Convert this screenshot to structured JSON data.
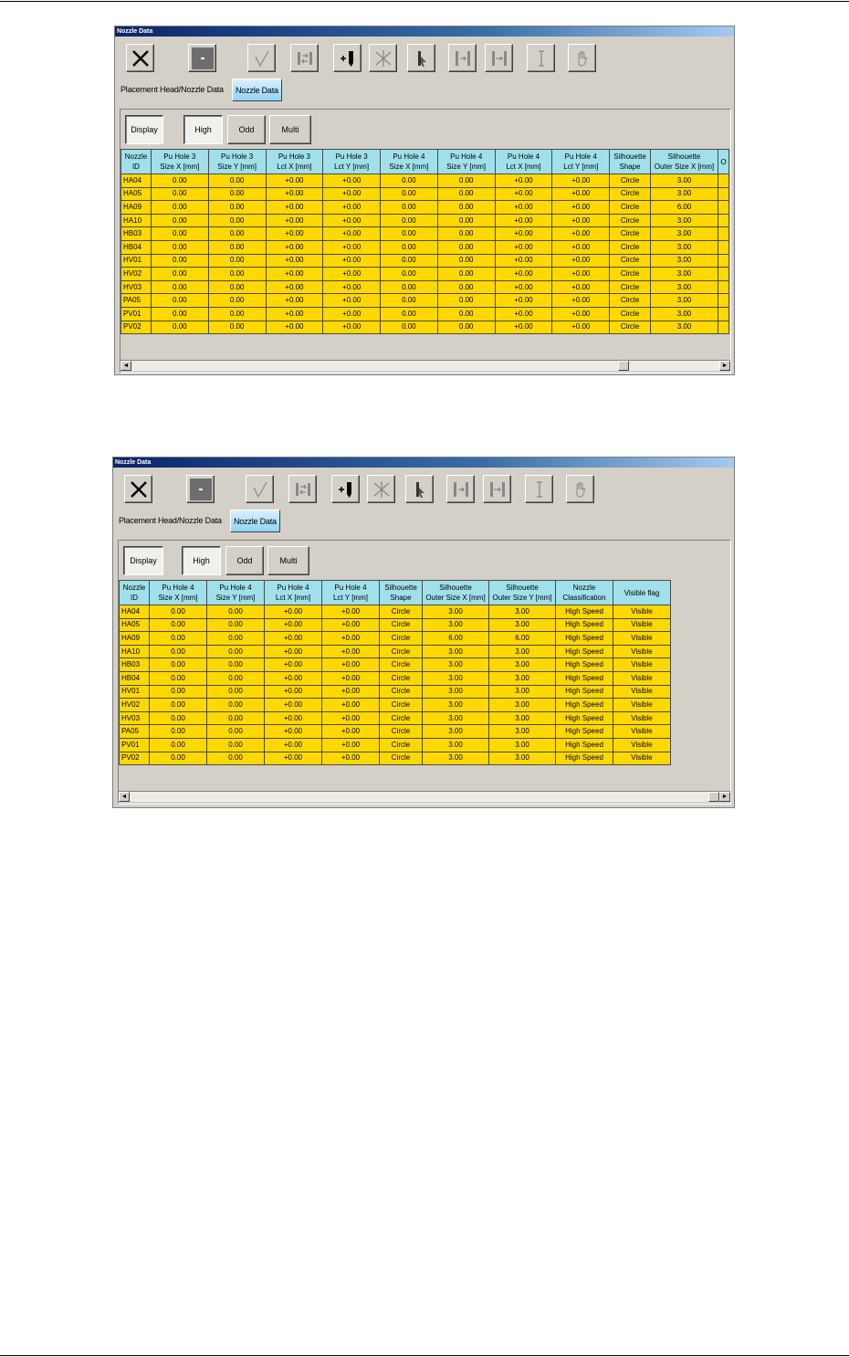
{
  "window_title": "Nozzle Data",
  "tabs": [
    "Placement Head/Nozzle Data",
    "Nozzle Data"
  ],
  "filters": [
    "Display",
    "High",
    "Odd",
    "Multi"
  ],
  "toolbar_icons": [
    "close-x-icon",
    "stop-icon",
    "checkmark-icon",
    "swap-icon",
    "add-nozzle-icon",
    "split-icon",
    "pointer-icon",
    "step-forward-icon",
    "skip-end-icon",
    "cursor-i-icon",
    "hand-icon"
  ],
  "scroll": {
    "left_arrow": "◄",
    "right_arrow": "►"
  },
  "colors": {
    "header": "#9fe0ea",
    "cell": "#ffd800",
    "active_tab": "#8fd3f5"
  },
  "grid1": {
    "headers": [
      [
        "Nozzle",
        "ID"
      ],
      [
        "Pu Hole 3",
        "Size X [mm]"
      ],
      [
        "Pu Hole 3",
        "Size Y [mm]"
      ],
      [
        "Pu Hole 3",
        "Lct X [mm]"
      ],
      [
        "Pu Hole 3",
        "Lct Y [mm]"
      ],
      [
        "Pu Hole 4",
        "Size X [mm]"
      ],
      [
        "Pu Hole 4",
        "Size Y [mm]"
      ],
      [
        "Pu Hole 4",
        "Lct X [mm]"
      ],
      [
        "Pu Hole 4",
        "Lct Y [mm]"
      ],
      [
        "Silhouette",
        "Shape"
      ],
      [
        "Silhouette",
        "Outer Size X [mm]"
      ],
      [
        "",
        "O"
      ]
    ],
    "rows": [
      [
        "HA04",
        "0.00",
        "0.00",
        "+0.00",
        "+0.00",
        "0.00",
        "0.00",
        "+0.00",
        "+0.00",
        "Circle",
        "3.00",
        ""
      ],
      [
        "HA05",
        "0.00",
        "0.00",
        "+0.00",
        "+0.00",
        "0.00",
        "0.00",
        "+0.00",
        "+0.00",
        "Circle",
        "3.00",
        ""
      ],
      [
        "HA09",
        "0.00",
        "0.00",
        "+0.00",
        "+0.00",
        "0.00",
        "0.00",
        "+0.00",
        "+0.00",
        "Circle",
        "6.00",
        ""
      ],
      [
        "HA10",
        "0.00",
        "0.00",
        "+0.00",
        "+0.00",
        "0.00",
        "0.00",
        "+0.00",
        "+0.00",
        "Circle",
        "3.00",
        ""
      ],
      [
        "HB03",
        "0.00",
        "0.00",
        "+0.00",
        "+0.00",
        "0.00",
        "0.00",
        "+0.00",
        "+0.00",
        "Circle",
        "3.00",
        ""
      ],
      [
        "HB04",
        "0.00",
        "0.00",
        "+0.00",
        "+0.00",
        "0.00",
        "0.00",
        "+0.00",
        "+0.00",
        "Circle",
        "3.00",
        ""
      ],
      [
        "HV01",
        "0.00",
        "0.00",
        "+0.00",
        "+0.00",
        "0.00",
        "0.00",
        "+0.00",
        "+0.00",
        "Circle",
        "3.00",
        ""
      ],
      [
        "HV02",
        "0.00",
        "0.00",
        "+0.00",
        "+0.00",
        "0.00",
        "0.00",
        "+0.00",
        "+0.00",
        "Circle",
        "3.00",
        ""
      ],
      [
        "HV03",
        "0.00",
        "0.00",
        "+0.00",
        "+0.00",
        "0.00",
        "0.00",
        "+0.00",
        "+0.00",
        "Circle",
        "3.00",
        ""
      ],
      [
        "PA05",
        "0.00",
        "0.00",
        "+0.00",
        "+0.00",
        "0.00",
        "0.00",
        "+0.00",
        "+0.00",
        "Circle",
        "3.00",
        ""
      ],
      [
        "PV01",
        "0.00",
        "0.00",
        "+0.00",
        "+0.00",
        "0.00",
        "0.00",
        "+0.00",
        "+0.00",
        "Circle",
        "3.00",
        ""
      ],
      [
        "PV02",
        "0.00",
        "0.00",
        "+0.00",
        "+0.00",
        "0.00",
        "0.00",
        "+0.00",
        "+0.00",
        "Circle",
        "3.00",
        ""
      ]
    ]
  },
  "grid2": {
    "headers": [
      [
        "Nozzle",
        "ID"
      ],
      [
        "Pu Hole 4",
        "Size X [mm]"
      ],
      [
        "Pu Hole 4",
        "Size Y [mm]"
      ],
      [
        "Pu Hole 4",
        "Lct X [mm]"
      ],
      [
        "Pu Hole 4",
        "Lct Y [mm]"
      ],
      [
        "Silhouette",
        "Shape"
      ],
      [
        "Silhouette",
        "Outer Size X [mm]"
      ],
      [
        "Silhouette",
        "Outer Size Y [mm]"
      ],
      [
        "Nozzle",
        "Classification"
      ],
      [
        "Visible flag",
        ""
      ]
    ],
    "rows": [
      [
        "HA04",
        "0.00",
        "0.00",
        "+0.00",
        "+0.00",
        "Circle",
        "3.00",
        "3.00",
        "High Speed",
        "Visible"
      ],
      [
        "HA05",
        "0.00",
        "0.00",
        "+0.00",
        "+0.00",
        "Circle",
        "3.00",
        "3.00",
        "High Speed",
        "Visible"
      ],
      [
        "HA09",
        "0.00",
        "0.00",
        "+0.00",
        "+0.00",
        "Circle",
        "6.00",
        "6.00",
        "High Speed",
        "Visible"
      ],
      [
        "HA10",
        "0.00",
        "0.00",
        "+0.00",
        "+0.00",
        "Circle",
        "3.00",
        "3.00",
        "High Speed",
        "Visible"
      ],
      [
        "HB03",
        "0.00",
        "0.00",
        "+0.00",
        "+0.00",
        "Circle",
        "3.00",
        "3.00",
        "High Speed",
        "Visible"
      ],
      [
        "HB04",
        "0.00",
        "0.00",
        "+0.00",
        "+0.00",
        "Circle",
        "3.00",
        "3.00",
        "High Speed",
        "Visible"
      ],
      [
        "HV01",
        "0.00",
        "0.00",
        "+0.00",
        "+0.00",
        "Circle",
        "3.00",
        "3.00",
        "High Speed",
        "Visible"
      ],
      [
        "HV02",
        "0.00",
        "0.00",
        "+0.00",
        "+0.00",
        "Circle",
        "3.00",
        "3.00",
        "High Speed",
        "Visible"
      ],
      [
        "HV03",
        "0.00",
        "0.00",
        "+0.00",
        "+0.00",
        "Circle",
        "3.00",
        "3.00",
        "High Speed",
        "Visible"
      ],
      [
        "PA05",
        "0.00",
        "0.00",
        "+0.00",
        "+0.00",
        "Circle",
        "3.00",
        "3.00",
        "High Speed",
        "Visible"
      ],
      [
        "PV01",
        "0.00",
        "0.00",
        "+0.00",
        "+0.00",
        "Circle",
        "3.00",
        "3.00",
        "High Speed",
        "Visible"
      ],
      [
        "PV02",
        "0.00",
        "0.00",
        "+0.00",
        "+0.00",
        "Circle",
        "3.00",
        "3.00",
        "High Speed",
        "Visible"
      ]
    ]
  }
}
